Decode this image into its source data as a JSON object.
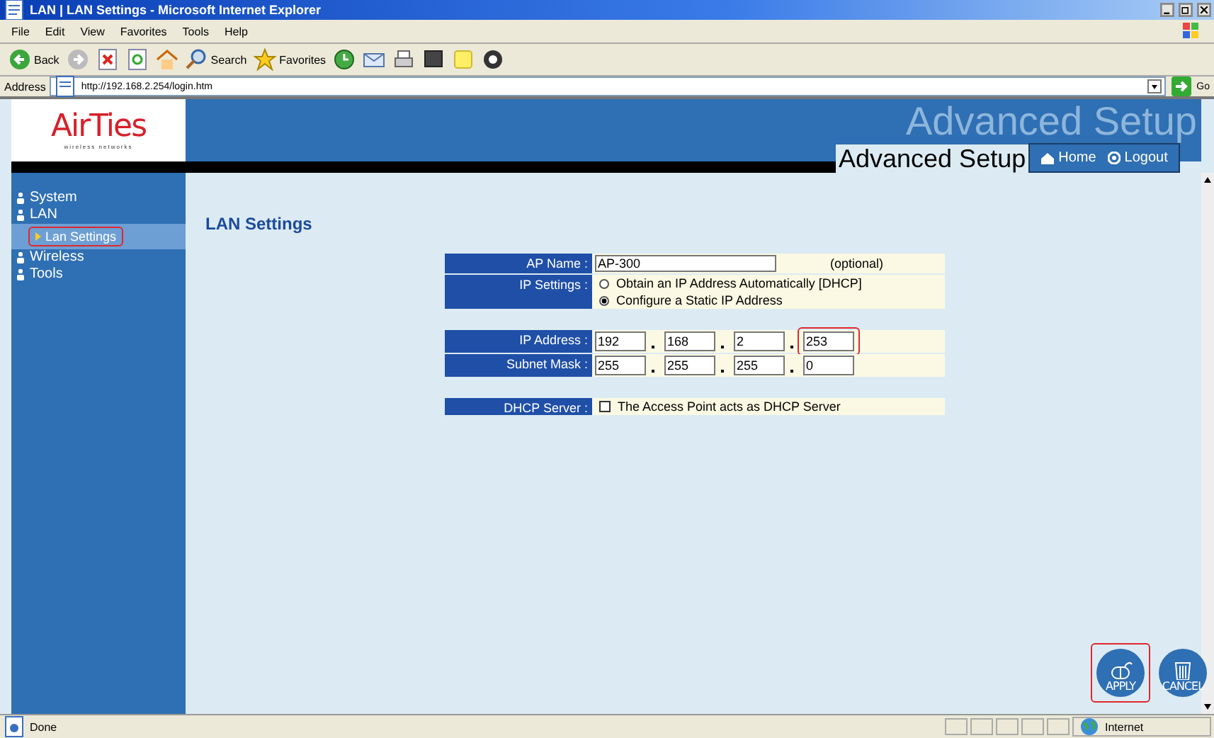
{
  "window": {
    "title": "LAN | LAN Settings - Microsoft Internet Explorer"
  },
  "menu": [
    "File",
    "Edit",
    "View",
    "Favorites",
    "Tools",
    "Help"
  ],
  "toolbar": [
    {
      "kind": "back",
      "label": "Back"
    },
    {
      "kind": "forward"
    },
    {
      "kind": "stop"
    },
    {
      "kind": "refresh"
    },
    {
      "kind": "home"
    },
    {
      "kind": "search",
      "label": "Search"
    },
    {
      "kind": "favorites",
      "label": "Favorites"
    },
    {
      "kind": "history"
    },
    {
      "kind": "mail"
    },
    {
      "kind": "print"
    },
    {
      "kind": "edit"
    },
    {
      "kind": "note"
    },
    {
      "kind": "messenger"
    }
  ],
  "address": {
    "label": "Address",
    "value": "http://192.168.2.254/login.htm",
    "go": "Go"
  },
  "header": {
    "logo": "AirTies",
    "tagline": "wireless networks",
    "watermark": "Advanced Setup",
    "title": "Advanced Setup",
    "links": [
      "Home",
      "Logout"
    ]
  },
  "nav": [
    {
      "label": "System"
    },
    {
      "label": "LAN",
      "children": [
        {
          "label": "Lan Settings",
          "selected": true,
          "highlighted": true
        }
      ]
    },
    {
      "label": "Wireless"
    },
    {
      "label": "Tools"
    }
  ],
  "content": {
    "heading": "LAN Settings",
    "sections": [
      [
        {
          "kind": "text",
          "label": "AP Name :",
          "value": "AP-300",
          "note": "(optional)"
        },
        {
          "kind": "radio",
          "label": "IP Settings :",
          "options": [
            {
              "label": "Obtain an IP Address Automatically [DHCP]",
              "selected": false
            },
            {
              "label": "Configure a Static IP Address",
              "selected": true
            }
          ]
        }
      ],
      [
        {
          "kind": "ip",
          "label": "IP Address :",
          "octets": [
            {
              "value": "192",
              "highlighted": false
            },
            {
              "value": "168",
              "highlighted": false
            },
            {
              "value": "2",
              "highlighted": false
            },
            {
              "value": "253",
              "highlighted": true
            }
          ]
        },
        {
          "kind": "ip",
          "label": "Subnet Mask :",
          "octets": [
            {
              "value": "255",
              "highlighted": false
            },
            {
              "value": "255",
              "highlighted": false
            },
            {
              "value": "255",
              "highlighted": false
            },
            {
              "value": "0",
              "highlighted": false
            }
          ]
        }
      ],
      [
        {
          "kind": "checkbox",
          "label": "DHCP Server :",
          "text": "The Access Point acts as DHCP Server",
          "checked": false
        }
      ]
    ]
  },
  "actions": [
    {
      "kind": "apply",
      "label": "APPLY",
      "highlighted": true
    },
    {
      "kind": "cancel",
      "label": "CANCEL",
      "highlighted": false
    }
  ],
  "status_bar": {
    "text": "Done",
    "zone": "Internet"
  }
}
